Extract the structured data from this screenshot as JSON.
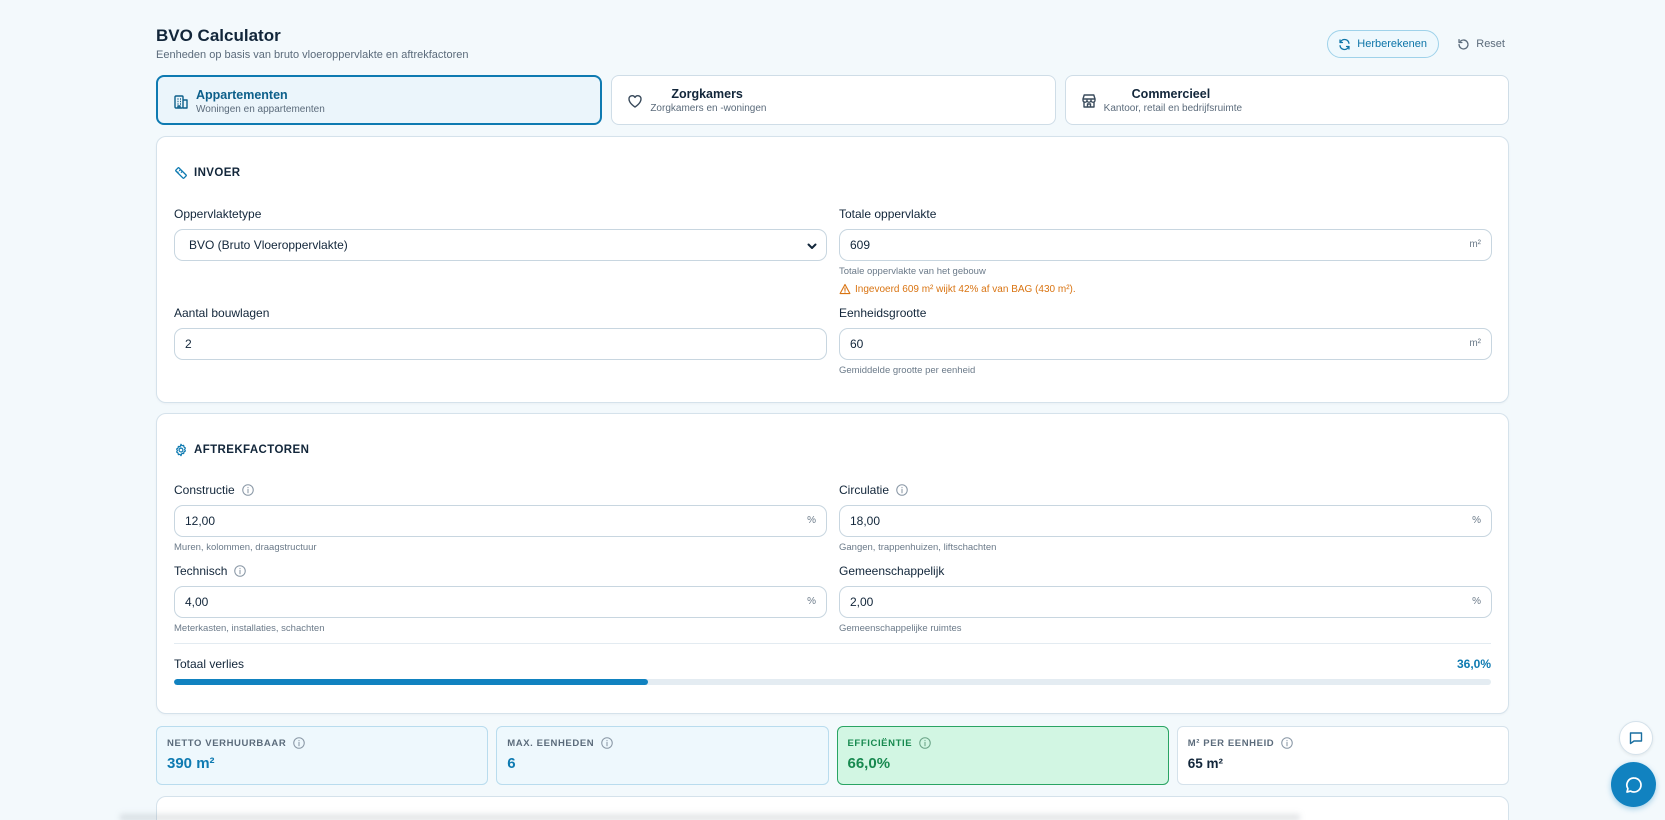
{
  "header": {
    "title": "BVO Calculator",
    "subtitle": "Eenheden op basis van bruto vloeroppervlakte en aftrekfactoren",
    "recalc_label": "Herberekenen",
    "reset_label": "Reset"
  },
  "tabs": [
    {
      "label": "Appartementen",
      "desc": "Woningen en appartementen",
      "icon": "building-icon",
      "active": true
    },
    {
      "label": "Zorgkamers",
      "desc": "Zorgkamers en -woningen",
      "icon": "heart-icon",
      "active": false
    },
    {
      "label": "Commercieel",
      "desc": "Kantoor, retail en bedrijfsruimte",
      "icon": "store-icon",
      "active": false
    }
  ],
  "invoer": {
    "title": "INVOER",
    "surface_type": {
      "label": "Oppervlaktetype",
      "value": "BVO (Bruto Vloeroppervlakte)"
    },
    "total_area": {
      "label": "Totale oppervlakte",
      "value": "609",
      "unit": "m²",
      "hint": "Totale oppervlakte van het gebouw",
      "warning": "Ingevoerd 609 m² wijkt 42% af van BAG (430 m²)."
    },
    "floors": {
      "label": "Aantal bouwlagen",
      "value": "2"
    },
    "unit_size": {
      "label": "Eenheidsgrootte",
      "value": "60",
      "unit": "m²",
      "hint": "Gemiddelde grootte per eenheid"
    }
  },
  "aftrek": {
    "title": "AFTREKFACTOREN",
    "construction": {
      "label": "Constructie",
      "value": "12,00",
      "unit": "%",
      "hint": "Muren, kolommen, draagstructuur"
    },
    "circulation": {
      "label": "Circulatie",
      "value": "18,00",
      "unit": "%",
      "hint": "Gangen, trappenhuizen, liftschachten"
    },
    "technical": {
      "label": "Technisch",
      "value": "4,00",
      "unit": "%",
      "hint": "Meterkasten, installaties, schachten"
    },
    "shared": {
      "label": "Gemeenschappelijk",
      "value": "2,00",
      "unit": "%",
      "hint": "Gemeenschappelijke ruimtes"
    },
    "total_loss_label": "Totaal verlies",
    "total_loss_value": "36,0%",
    "total_loss_fraction": 0.36
  },
  "stats": [
    {
      "label": "NETTO VERHUURBAAR",
      "value": "390 m²"
    },
    {
      "label": "MAX. EENHEDEN",
      "value": "6"
    },
    {
      "label": "EFFICIËNTIE",
      "value": "66,0%"
    },
    {
      "label": "M² PER EENHEID",
      "value": "65 m²"
    }
  ],
  "colors": {
    "accent": "#0e7ab1",
    "success": "#17894f",
    "warning": "#d97412",
    "background": "#f3f9fc"
  }
}
